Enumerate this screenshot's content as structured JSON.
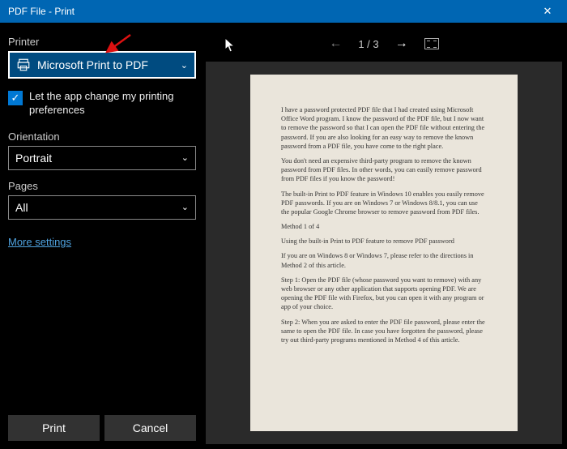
{
  "titlebar": {
    "title": "PDF File - Print"
  },
  "left": {
    "printer_label": "Printer",
    "printer_value": "Microsoft Print to PDF",
    "checkbox_label": "Let the app change my printing preferences",
    "orientation_label": "Orientation",
    "orientation_value": "Portrait",
    "pages_label": "Pages",
    "pages_value": "All",
    "more_settings": "More settings",
    "print_btn": "Print",
    "cancel_btn": "Cancel"
  },
  "preview": {
    "page_indicator": "1  /  3",
    "paragraphs": [
      "I have a password protected PDF file that I had created using Microsoft Office Word program. I know the password of the PDF file, but I now want to remove the password so that I can open the PDF file without entering the password. If you are also looking for an easy way to remove the known password from a PDF file, you have come to the right place.",
      "You don't need an expensive third-party program to remove the known password from PDF files. In other words, you can easily remove password from PDF files if you know the password!",
      "The built-in Print to PDF feature in Windows 10 enables you easily remove PDF passwords. If you are on Windows 7 or Windows 8/8.1, you can use the popular Google Chrome browser to remove password from PDF files.",
      "Method 1 of 4",
      "Using the built-in Print to PDF feature to remove PDF password",
      "If you are on Windows 8 or Windows 7, please refer to the directions in Method 2 of this article.",
      "Step 1: Open the PDF file (whose password you want to remove) with any web browser or any other application that supports opening PDF. We are opening the PDF file with Firefox, but you can open it with any program or app of your choice.",
      "Step 2: When you are asked to enter the PDF file password, please enter the same to open the PDF file. In case you have forgotten the password, please try out third-party programs mentioned in Method 4 of this article."
    ]
  }
}
